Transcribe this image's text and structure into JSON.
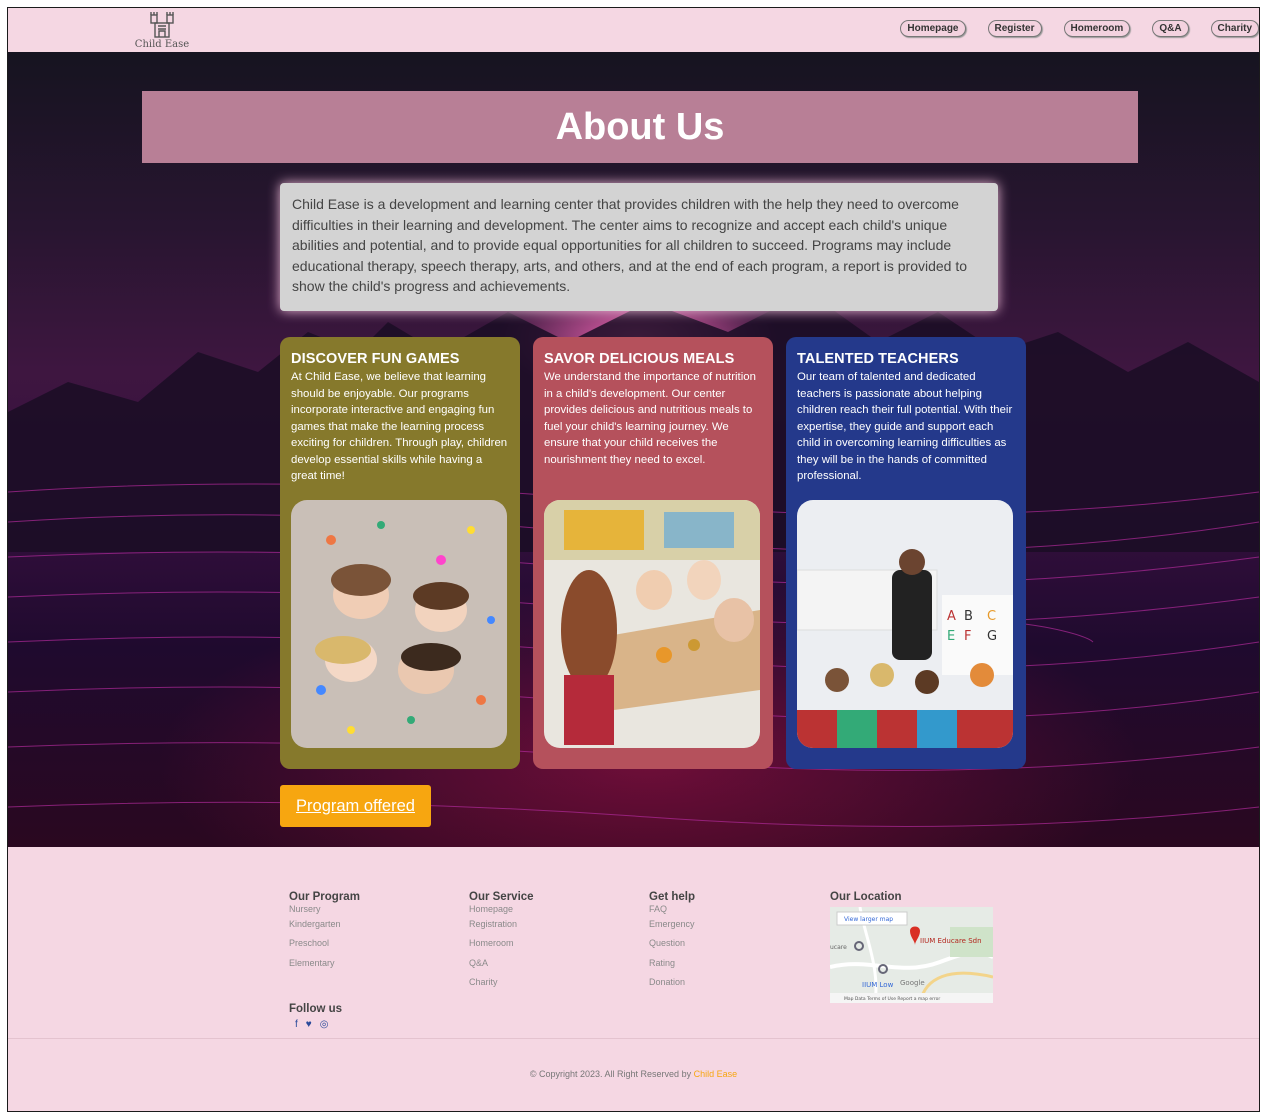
{
  "brand": {
    "logo_text": "Child Ease"
  },
  "nav": [
    "Homepage",
    "Register",
    "Homeroom",
    "Q&A",
    "Charity"
  ],
  "about": {
    "title": "About Us",
    "intro": "Child Ease is a development and learning center that provides children with the help they need to overcome difficulties in their learning and development. The center aims to recognize and accept each child's unique abilities and potential, and to provide equal opportunities for all children to succeed. Programs may include educational therapy, speech therapy, arts, and others, and at the end of each program, a report is provided to show the child's progress and achievements."
  },
  "cards": [
    {
      "title": "DISCOVER FUN GAMES",
      "text": "At Child Ease, we believe that learning should be enjoyable. Our programs incorporate interactive and engaging fun games that make the learning process exciting for children. Through play, children develop essential skills while having a great time!",
      "color": "#86792c"
    },
    {
      "title": "SAVOR DELICIOUS MEALS",
      "text": "We understand the importance of nutrition in a child's development. Our center provides delicious and nutritious meals to fuel your child's learning journey. We ensure that your child receives the nourishment they need to excel.",
      "color": "#b5515c"
    },
    {
      "title": "TALENTED TEACHERS",
      "text": "Our team of talented and dedicated teachers is passionate about helping children reach their full potential. With their expertise, they guide and support each child in overcoming learning difficulties as they will be in the hands of committed professional.",
      "color": "#24398b"
    }
  ],
  "cta": {
    "label": "Program offered",
    "color": "#f7a610"
  },
  "footer": {
    "columns": [
      {
        "title": "Our Program",
        "links": [
          "Nursery",
          "Kindergarten",
          "Preschool",
          "Elementary"
        ]
      },
      {
        "title": "Our Service",
        "links": [
          "Homepage",
          "Registration",
          "Homeroom",
          "Q&A",
          "Charity"
        ]
      },
      {
        "title": "Get help",
        "links": [
          "FAQ",
          "Emergency",
          "Question",
          "Rating",
          "Donation"
        ]
      }
    ],
    "location": {
      "title": "Our Location",
      "map_button": "View larger map",
      "place": "IIUM Educare Sdn",
      "place2": "IIUM Low",
      "google": "Google",
      "attribution": "Map Data   Terms of Use   Report a map error",
      "left_label": "ucare"
    },
    "follow": {
      "title": "Follow us",
      "icons": [
        "facebook-icon",
        "twitter-icon",
        "instagram-icon"
      ]
    },
    "copyright": "© Copyright 2023. All Right Reserved by",
    "copyright_brand": "Child Ease"
  },
  "colors": {
    "header_bg": "#f5d7e3",
    "about_bar": "#b87f96",
    "accent": "#f7a610"
  }
}
